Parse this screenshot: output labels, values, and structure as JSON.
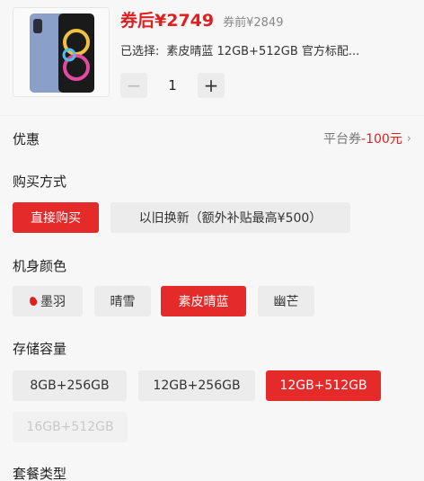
{
  "product": {
    "price_after_coupon": "券后¥2749",
    "price_before_coupon": "券前¥2849",
    "selected_label": "已选择:",
    "selected_value": "素皮晴蓝 12GB+512GB 官方标配..."
  },
  "quantity": {
    "minus": "−",
    "value": "1",
    "plus": "+"
  },
  "promotion": {
    "title": "优惠",
    "coupon_prefix": "平台券",
    "coupon_amount": "-100元",
    "chevron": "›"
  },
  "purchase": {
    "title": "购买方式",
    "options": [
      "直接购买",
      "以旧换新（额外补贴最高¥500）"
    ]
  },
  "color": {
    "title": "机身颜色",
    "options": [
      "墨羽",
      "晴雪",
      "素皮晴蓝",
      "幽芒"
    ]
  },
  "storage": {
    "title": "存储容量",
    "options": [
      "8GB+256GB",
      "12GB+256GB",
      "12GB+512GB",
      "16GB+512GB"
    ]
  },
  "package": {
    "title": "套餐类型"
  },
  "colors": {
    "accent": "#e52a2a",
    "price_red": "#e02020",
    "option_bg": "#ececec"
  }
}
